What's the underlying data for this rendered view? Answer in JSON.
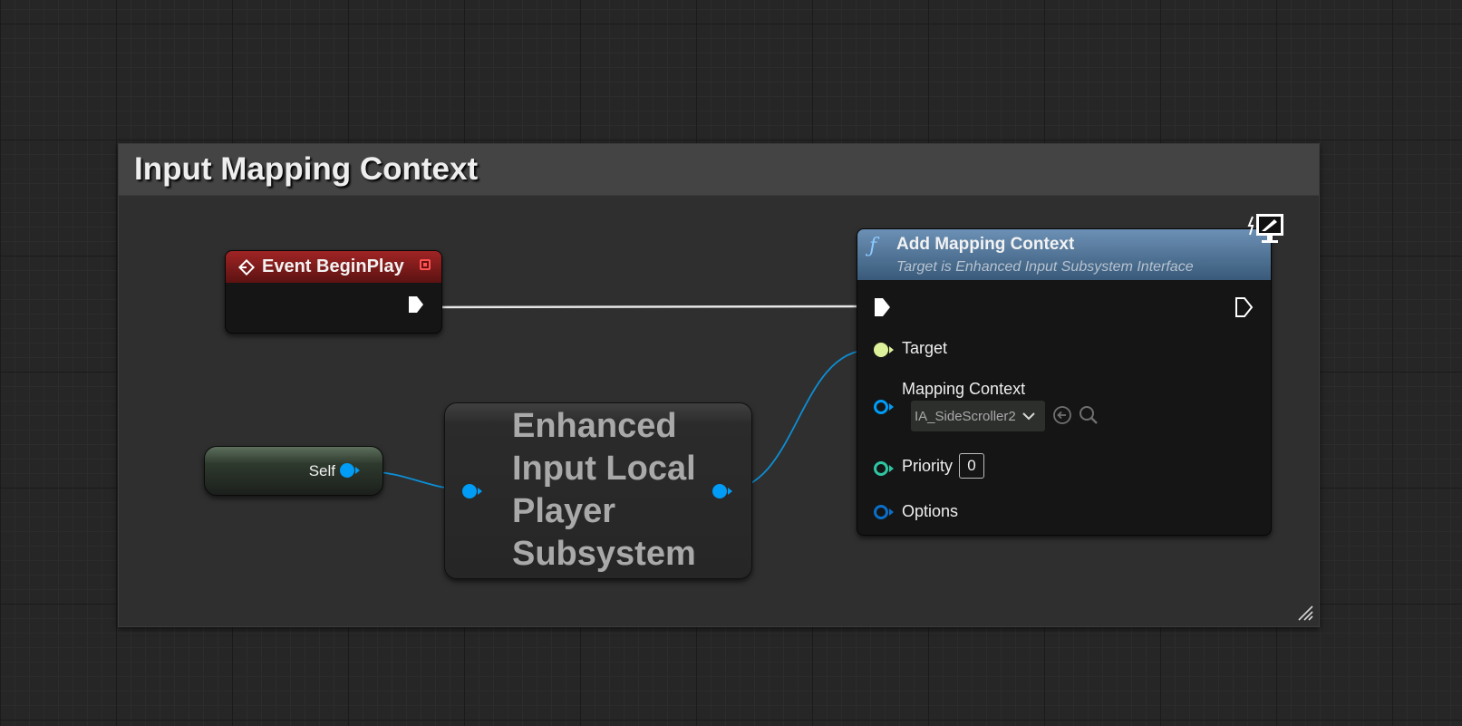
{
  "comment": {
    "title": "Input Mapping Context"
  },
  "event_node": {
    "title": "Event BeginPlay"
  },
  "self_node": {
    "label": "Self"
  },
  "subsystem_node": {
    "title": "Enhanced Input Local Player Subsystem"
  },
  "mapping_node": {
    "title": "Add Mapping Context",
    "subtitle": "Target is Enhanced Input Subsystem Interface",
    "pins": {
      "target": "Target",
      "mapping_context": "Mapping Context",
      "mapping_context_value": "IA_SideScroller2",
      "priority": "Priority",
      "priority_value": "0",
      "options": "Options"
    }
  },
  "colors": {
    "exec": "#ffffff",
    "object_pin": "#009cf5",
    "target_pin": "#ddf09a",
    "priority_pin": "#2fc6a3",
    "event_header": "#a02424",
    "function_header": "#5f86ad"
  },
  "icons": [
    "event-icon",
    "stop-icon",
    "function-icon",
    "monitor-icon",
    "use-asset-icon",
    "browse-icon",
    "chevron-down-icon",
    "resize-icon"
  ]
}
